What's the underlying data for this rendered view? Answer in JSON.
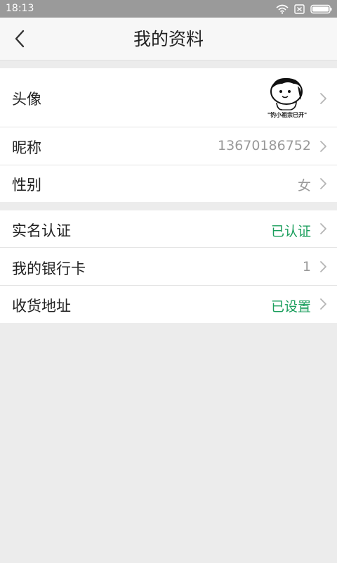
{
  "status_bar": {
    "time": "18:13",
    "icons": [
      "wifi-icon",
      "sim-icon",
      "battery-icon"
    ]
  },
  "header": {
    "title": "我的资料",
    "back_icon": "chevron-left-icon"
  },
  "profile_rows": [
    {
      "label": "头像",
      "value": "",
      "avatar_caption": "\"钓小祖宗已开\""
    },
    {
      "label": "昵称",
      "value": "13670186752"
    },
    {
      "label": "性别",
      "value": "女"
    }
  ],
  "account_rows": [
    {
      "label": "实名认证",
      "value": "已认证"
    },
    {
      "label": "我的银行卡",
      "value": "1"
    },
    {
      "label": "收货地址",
      "value": "已设置"
    }
  ],
  "colors": {
    "status_bar": "#9a9a9a",
    "nav_bar": "#f7f7f7",
    "page_background": "#ececec",
    "status_green": "#1a9e5c",
    "secondary_text": "#999999"
  }
}
